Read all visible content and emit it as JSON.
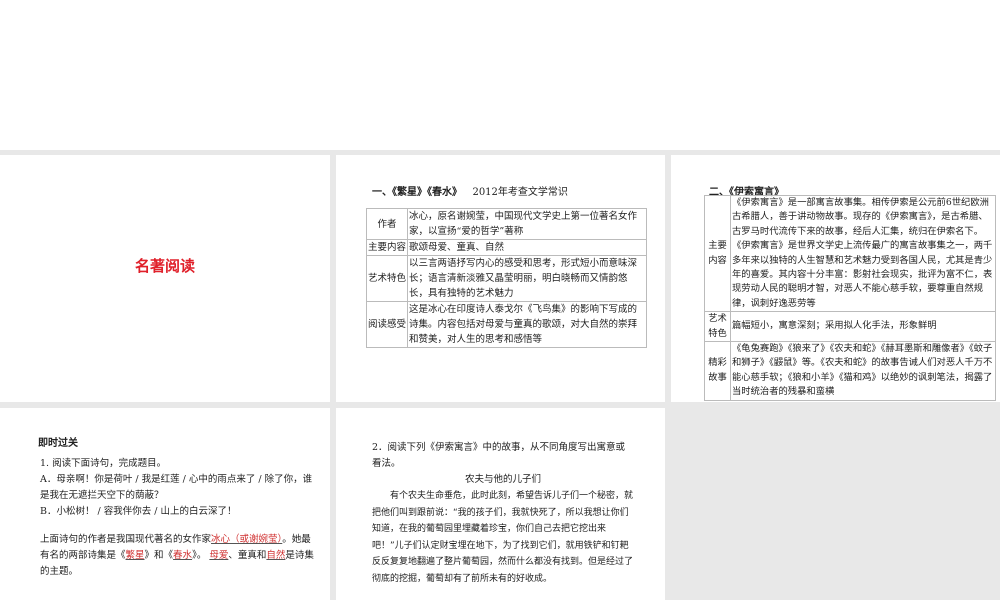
{
  "slide1": {
    "title": "名著阅读"
  },
  "slide2": {
    "heading": "一、《繁星》《春水》",
    "note": "2012年考查文学常识",
    "rows": [
      {
        "key": "作者",
        "value": "冰心，原名谢婉莹，中国现代文学史上第一位著名女作家，以宣扬“爱的哲学”著称"
      },
      {
        "key": "主要内容",
        "value": "歌颂母爱、童真、自然"
      },
      {
        "key": "艺术特色",
        "value": "以三言两语抒写内心的感受和思考，形式短小而意味深长；语言清新淡雅又晶莹明丽，明白晓畅而又情韵悠长，具有独特的艺术魅力"
      },
      {
        "key": "阅读感受",
        "value": "这是冰心在印度诗人泰戈尔《飞鸟集》的影响下写成的诗集。内容包括对母爱与童真的歌颂，对大自然的崇拜和赞美，对人生的思考和感悟等"
      }
    ]
  },
  "slide3": {
    "heading": "二、《伊索寓言》",
    "rows": [
      {
        "key": "主要内容",
        "value": "《伊索寓言》是一部寓言故事集。相传伊索是公元前6世纪欧洲古希腊人，善于讲动物故事。现存的《伊索寓言》，是古希腊、古罗马时代流传下来的故事，经后人汇集，统归在伊索名下。《伊索寓言》是世界文学史上流传最广的寓言故事集之一，两千多年来以独特的人生智慧和艺术魅力受到各国人民，尤其是青少年的喜爱。其内容十分丰富：影射社会现实，批评为富不仁，表现劳动人民的聪明才智，对恶人不能心慈手软，要尊重自然规律，讽刺好逸恶劳等"
      },
      {
        "key": "艺术特色",
        "value": "篇幅短小，寓意深刻；采用拟人化手法，形象鲜明"
      },
      {
        "key": "精彩故事",
        "value": "《龟兔赛跑》《狼来了》《农夫和蛇》《赫耳墨斯和雕像者》《蚊子和狮子》《鼹鼠》等。《农夫和蛇》的故事告诫人们对恶人千万不能心慈手软；《狼和小羊》《猫和鸡》以绝妙的讽刺笔法，揭露了当时统治者的残暴和蛮横"
      }
    ]
  },
  "slide4": {
    "heading": "即时过关",
    "q1": "1. 阅读下面诗句，完成题目。",
    "a": "A．母亲啊！你是荷叶 / 我是红莲 / 心中的雨点来了 / 除了你，谁是我在无遮拦天空下的荫蔽？",
    "b": "B．小松树！ / 容我伴你去 / 山上的白云深了！",
    "s1": "上面诗句的作者是我国现代著名的女作家",
    "ans1": "冰心（或谢婉莹）",
    "s2": "。她最有名的两部诗集是《",
    "ans2": "繁星",
    "s3": "》和《",
    "ans3": "春水",
    "s4": "》。",
    "ans4": "母爱",
    "s5": "、童真和",
    "ans5": "自然",
    "s6": "是诗集的主题。"
  },
  "slide5": {
    "q2": "2．阅读下列《伊索寓言》中的故事，从不同角度写出寓意或看法。",
    "story_title": "农夫与他的儿子们",
    "story": "有个农夫生命垂危，此时此刻，希望告诉儿子们一个秘密，就把他们叫到跟前说：“我的孩子们，我就快死了，所以我想让你们知道，在我的葡萄园里埋藏着珍宝，你们自己去把它挖出来吧！”儿子们认定财宝埋在地下，为了找到它们，就用铁铲和钉耙反反复复地翻遍了整片葡萄园，然而什么都没有找到。但是经过了彻底的挖掘，葡萄却有了前所未有的好收成。"
  }
}
